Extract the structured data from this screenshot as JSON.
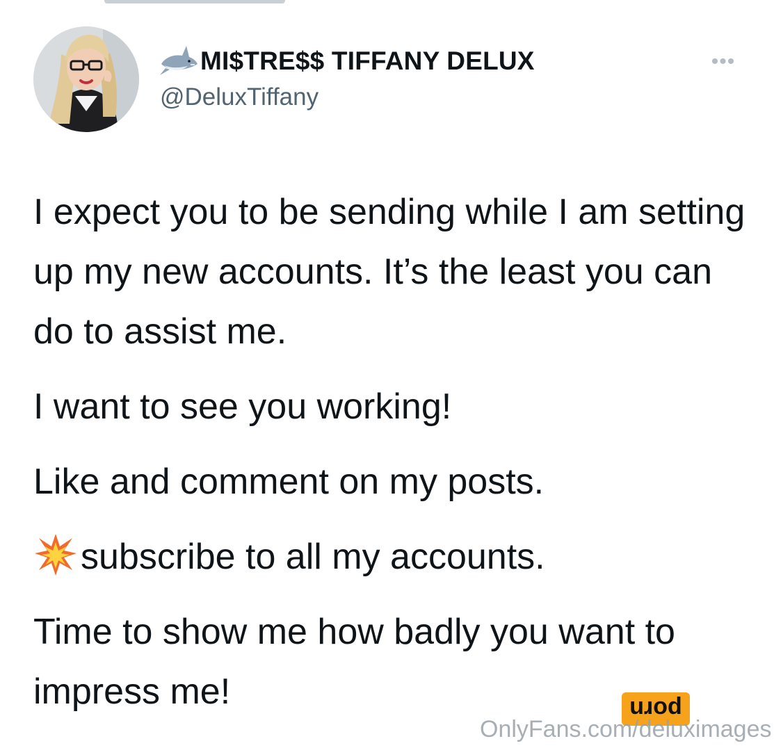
{
  "header": {
    "display_name": "MI$TRE$$ TIFFANY DELUX",
    "handle": "@DeluxTiffany",
    "more_label": "•••",
    "name_icon": "shark-icon",
    "avatar_icon": "profile-avatar"
  },
  "tweet": {
    "paragraph_1": "I expect you to be sending while I am setting up my new accounts. It’s the least you can do to assist me.",
    "paragraph_2": "I want to see you working!",
    "paragraph_3": "Like and comment on my posts.",
    "paragraph_4_icon": "collision-burst-icon",
    "paragraph_4": "subscribe to all my accounts.",
    "paragraph_5": "Time to show me how badly you want to impress me!"
  },
  "watermark": {
    "badge_text": "porn",
    "url_text": "OnlyFans.com/deluximages"
  },
  "colors": {
    "text": "#0f1419",
    "handle": "#536471",
    "badge_bg": "#f7a21b",
    "watermark": "#9aa2a8"
  }
}
